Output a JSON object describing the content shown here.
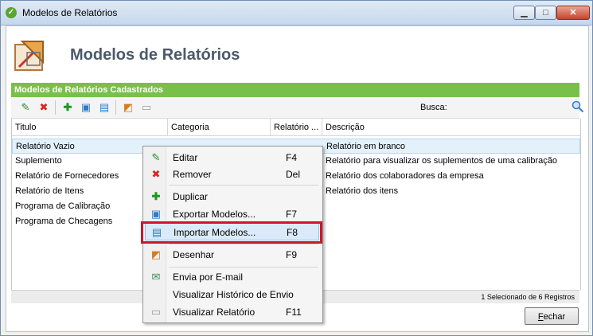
{
  "window": {
    "title": "Modelos de Relatórios"
  },
  "header": {
    "title": "Modelos de Relatórios"
  },
  "group": {
    "title": "Modelos de Relatórios Cadastrados"
  },
  "search": {
    "label": "Busca:",
    "value": ""
  },
  "table": {
    "columns": [
      "Titulo",
      "Categoria",
      "Relatório ...",
      "Descrição"
    ],
    "rows": [
      {
        "titulo": "Relatório Vazio",
        "categoria": "",
        "relatorio": "",
        "descricao": "Relatório em branco",
        "selected": true
      },
      {
        "titulo": "Suplemento",
        "categoria": "",
        "relatorio": "",
        "descricao": "Relatório para visualizar os suplementos de uma calibração"
      },
      {
        "titulo": "Relatório de Fornecedores",
        "categoria": "",
        "relatorio": "",
        "descricao": "Relatório dos colaboradores da empresa"
      },
      {
        "titulo": "Relatório de Itens",
        "categoria": "",
        "relatorio": "",
        "descricao": "Relatório dos itens"
      },
      {
        "titulo": "Programa de Calibração",
        "categoria": "",
        "relatorio": "",
        "descricao": ""
      },
      {
        "titulo": "Programa de Checagens",
        "categoria": "",
        "relatorio": "",
        "descricao": ""
      }
    ]
  },
  "status": {
    "text": "1 Selecionado de 6 Registros"
  },
  "footer": {
    "close_label_prefix": "",
    "close_label_accel": "F",
    "close_label_rest": "echar"
  },
  "context_menu": [
    {
      "label": "Editar",
      "shortcut": "F4",
      "icon": "edit-icon"
    },
    {
      "label": "Remover",
      "shortcut": "Del",
      "icon": "remove-icon"
    },
    {
      "label": "Duplicar",
      "shortcut": "",
      "icon": "duplicate-icon"
    },
    {
      "label": "Exportar Modelos...",
      "shortcut": "F7",
      "icon": "export-icon"
    },
    {
      "label": "Importar Modelos...",
      "shortcut": "F8",
      "icon": "import-icon"
    },
    {
      "label": "Desenhar",
      "shortcut": "F9",
      "icon": "design-icon"
    },
    {
      "label": "Envia por E-mail",
      "shortcut": "",
      "icon": "email-icon"
    },
    {
      "label": "Visualizar Histórico de Envio",
      "shortcut": "",
      "icon": ""
    },
    {
      "label": "Visualizar Relatório",
      "shortcut": "F11",
      "icon": "view-report-icon"
    }
  ],
  "colors": {
    "accent_green": "#79c04a",
    "highlight_red": "#d0142b",
    "selection_blue": "#e3f1fb"
  }
}
